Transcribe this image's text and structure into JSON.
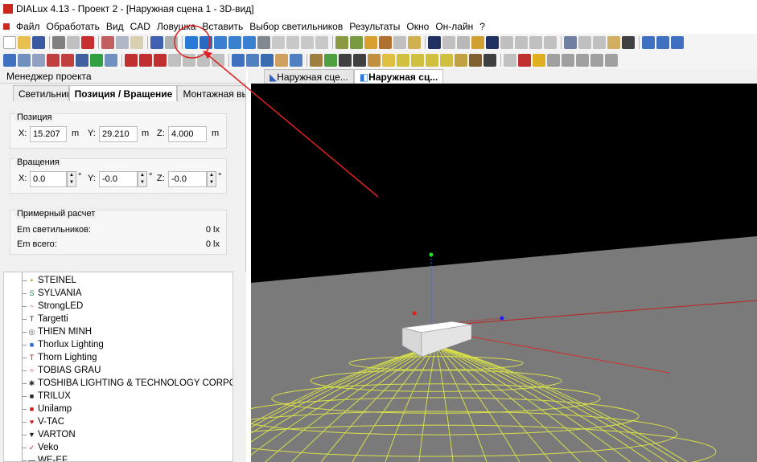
{
  "window": {
    "title": "DIALux 4.13 - Проект 2 - [Наружная сцена 1 - 3D-вид]"
  },
  "menu": [
    "Файл",
    "Обработать",
    "Вид",
    "CAD",
    "Ловушка",
    "Вставить",
    "Выбор светильников",
    "Результаты",
    "Окно",
    "Он-лайн",
    "?"
  ],
  "project_manager": {
    "title": "Менеджер проекта",
    "tabs": [
      "Светильник",
      "Позиция / Вращение",
      "Монтажная вы"
    ],
    "position": {
      "title": "Позиция",
      "x_label": "X:",
      "x_value": "15.207",
      "x_unit": "m",
      "y_label": "Y:",
      "y_value": "29.210",
      "y_unit": "m",
      "z_label": "Z:",
      "z_value": "4.000",
      "z_unit": "m"
    },
    "rotation": {
      "title": "Вращения",
      "x_label": "X:",
      "x_value": "0.0",
      "x_unit": "°",
      "y_label": "Y:",
      "y_value": "-0.0",
      "y_unit": "°",
      "z_label": "Z:",
      "z_value": "-0.0",
      "z_unit": "°"
    },
    "estimate": {
      "title": "Примерный расчет",
      "em_lum_label": "Em светильников:",
      "em_lum_value": "0 lx",
      "em_all_label": "Em всего:",
      "em_all_value": "0 lx"
    },
    "manufacturers": [
      {
        "name": "STEINEL",
        "icon": "•",
        "color": "#c87800"
      },
      {
        "name": "SYLVANIA",
        "icon": "S",
        "color": "#1a8a3a"
      },
      {
        "name": "StrongLED",
        "icon": "~",
        "color": "#d04080"
      },
      {
        "name": "Targetti",
        "icon": "T",
        "color": "#333333"
      },
      {
        "name": "THIEN MINH",
        "icon": "◎",
        "color": "#555555"
      },
      {
        "name": "Thorlux Lighting",
        "icon": "■",
        "color": "#2a6ad0"
      },
      {
        "name": "Thorn Lighting",
        "icon": "T",
        "color": "#c81e1e"
      },
      {
        "name": "TOBIAS GRAU",
        "icon": "≈",
        "color": "#d06060"
      },
      {
        "name": "TOSHIBA LIGHTING & TECHNOLOGY CORPORAT",
        "icon": "✱",
        "color": "#333333"
      },
      {
        "name": "TRILUX",
        "icon": "■",
        "color": "#222222"
      },
      {
        "name": "Unilamp",
        "icon": "■",
        "color": "#c81e1e"
      },
      {
        "name": "V-TAC",
        "icon": "♥",
        "color": "#c81e1e"
      },
      {
        "name": "VARTON",
        "icon": "▼",
        "color": "#222222"
      },
      {
        "name": "Veko",
        "icon": "✓",
        "color": "#c81e1e"
      },
      {
        "name": "WE-EF",
        "icon": "▬",
        "color": "#222222"
      }
    ]
  },
  "doc_tabs": [
    {
      "label": "Наружная сце...",
      "active": false
    },
    {
      "label": "Наружная сц...",
      "active": true
    }
  ],
  "colors": {
    "annotation": "#e02020",
    "ground": "#7a7a7a",
    "sky": "#000000",
    "light_cone": "#d8e04a"
  }
}
